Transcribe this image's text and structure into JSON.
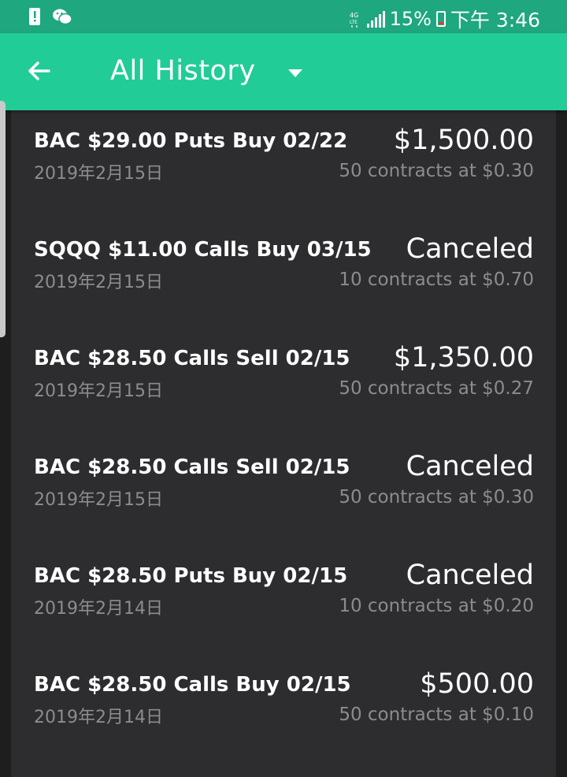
{
  "status_bar": {
    "network": "4G",
    "battery": "15%",
    "time": "下午 3:46",
    "icons": [
      "alert-icon",
      "wechat-icon",
      "network-4g-icon",
      "signal-icon",
      "battery-icon"
    ]
  },
  "app_bar": {
    "title": "All History",
    "background": "#21cc97"
  },
  "history": [
    {
      "name": "BAC $29.00 Puts Buy 02/22",
      "date": "2019年2月15日",
      "amount": "$1,500.00",
      "detail": "50 contracts at $0.30"
    },
    {
      "name": "SQQQ $11.00 Calls Buy 03/15",
      "date": "2019年2月15日",
      "amount": "Canceled",
      "detail": "10 contracts at $0.70"
    },
    {
      "name": "BAC $28.50 Calls Sell 02/15",
      "date": "2019年2月15日",
      "amount": "$1,350.00",
      "detail": "50 contracts at $0.27"
    },
    {
      "name": "BAC $28.50 Calls Sell 02/15",
      "date": "2019年2月15日",
      "amount": "Canceled",
      "detail": "50 contracts at $0.30"
    },
    {
      "name": "BAC $28.50 Puts Buy 02/15",
      "date": "2019年2月14日",
      "amount": "Canceled",
      "detail": "10 contracts at $0.20"
    },
    {
      "name": "BAC $28.50 Calls Buy 02/15",
      "date": "2019年2月14日",
      "amount": "$500.00",
      "detail": "50 contracts at $0.10"
    }
  ]
}
